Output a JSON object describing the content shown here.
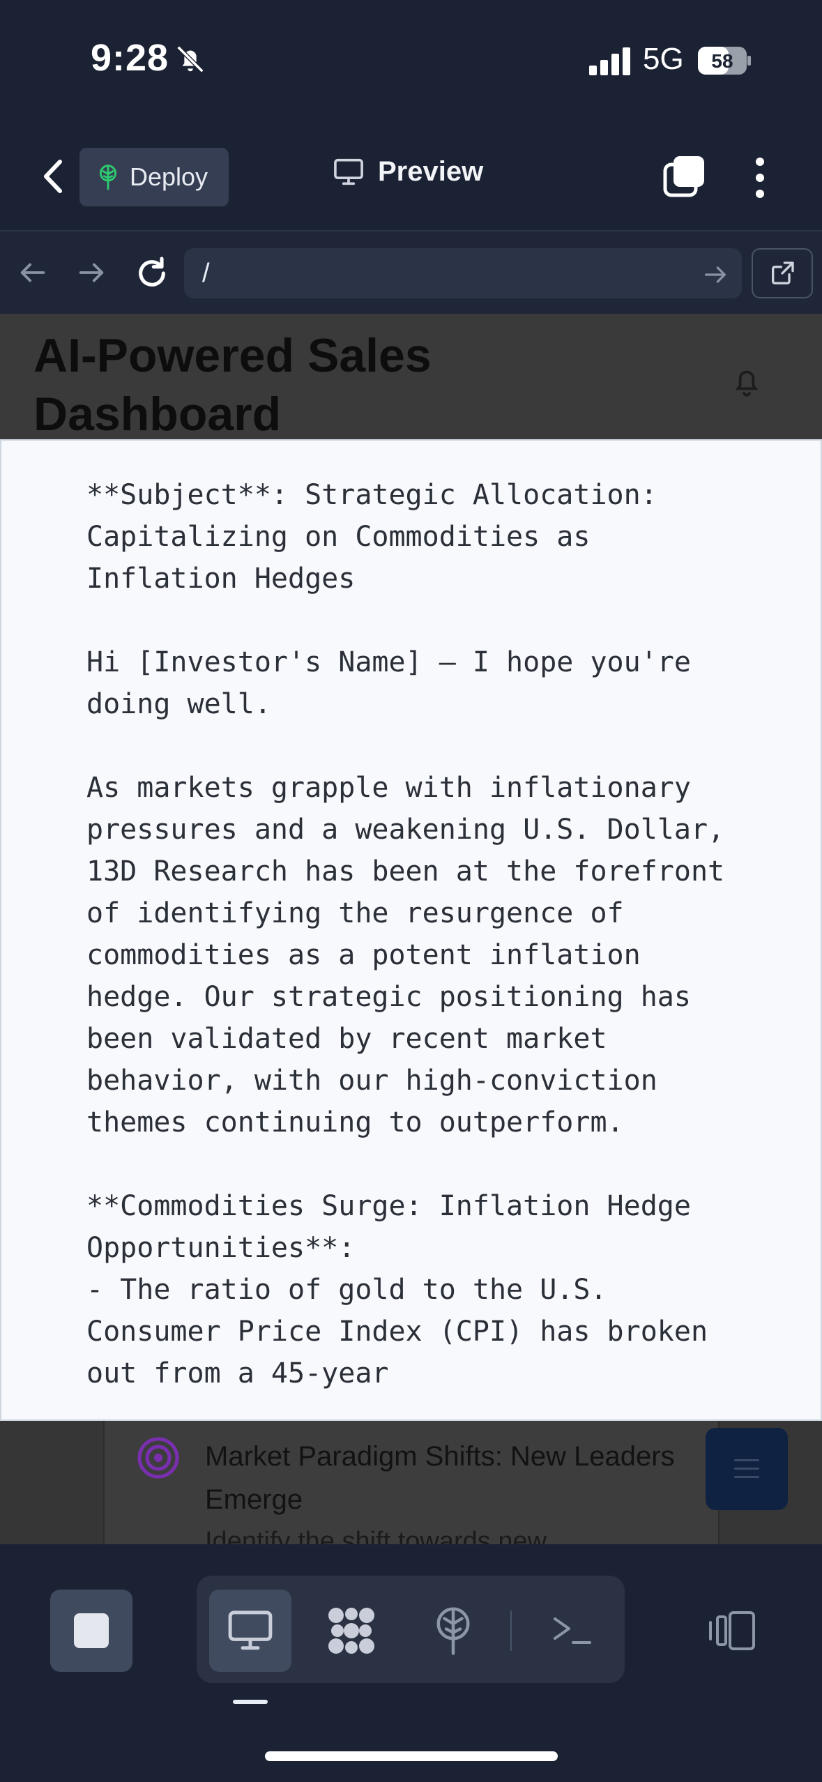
{
  "status_bar": {
    "time": "9:28",
    "network": "5G",
    "battery": "58"
  },
  "top_bar": {
    "deploy_label": "Deploy",
    "preview_label": "Preview"
  },
  "url_bar": {
    "url": "/"
  },
  "page": {
    "title": "AI-Powered Sales Dashboard"
  },
  "modal": {
    "text": "**Subject**: Strategic Allocation: Capitalizing on Commodities as Inflation Hedges\n\nHi [Investor's Name] — I hope you're doing well.\n\nAs markets grapple with inflationary pressures and a weakening U.S. Dollar, 13D Research has been at the forefront of identifying the resurgence of commodities as a potent inflation hedge. Our strategic positioning has been validated by recent market behavior, with our high-conviction themes continuing to outperform.\n\n**Commodities Surge: Inflation Hedge Opportunities**:\n- The ratio of gold to the U.S. Consumer Price Index (CPI) has broken out from a 45-year"
  },
  "card": {
    "title": "Market Paradigm Shifts: New Leaders Emerge",
    "subtitle": "Identify the shift towards new"
  },
  "colors": {
    "background": "#1b2233",
    "accent_green": "#2ecc71",
    "fab_navy": "#0f2242",
    "card_icon_purple": "#7a2fb0"
  },
  "icons": {
    "deploy": "deploy-tree-icon",
    "preview": "monitor-icon",
    "tabs": "tabs-icon",
    "more": "more-vertical-icon",
    "apps": "apps-icon",
    "shell": "terminal-icon"
  }
}
